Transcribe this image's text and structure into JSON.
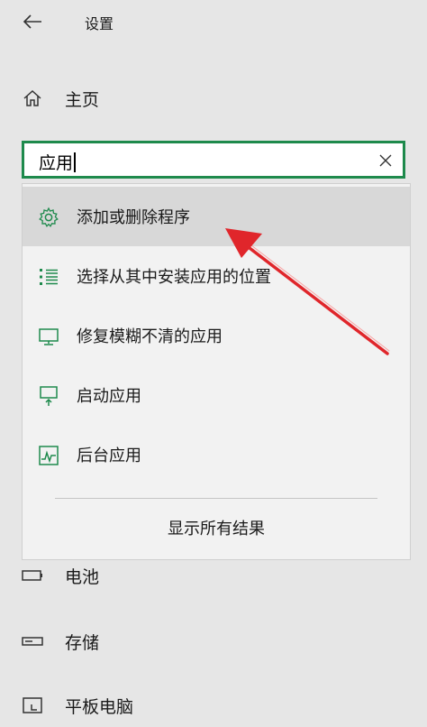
{
  "window": {
    "title": "设置"
  },
  "nav": {
    "home_label": "主页",
    "items": [
      {
        "label": "电池",
        "icon": "battery-icon"
      },
      {
        "label": "存储",
        "icon": "storage-icon"
      },
      {
        "label": "平板电脑",
        "icon": "tablet-mode-icon"
      }
    ]
  },
  "search": {
    "value": "应用",
    "clear_icon": "close-icon"
  },
  "suggestions": {
    "items": [
      {
        "label": "添加或删除程序",
        "icon": "gear-icon"
      },
      {
        "label": "选择从其中安装应用的位置",
        "icon": "list-icon"
      },
      {
        "label": "修复模糊不清的应用",
        "icon": "monitor-icon"
      },
      {
        "label": "启动应用",
        "icon": "startup-icon"
      },
      {
        "label": "后台应用",
        "icon": "activity-icon"
      }
    ],
    "show_all_label": "显示所有结果"
  },
  "colors": {
    "accent": "#1e8a4c",
    "annotation_arrow": "#e0262b"
  }
}
